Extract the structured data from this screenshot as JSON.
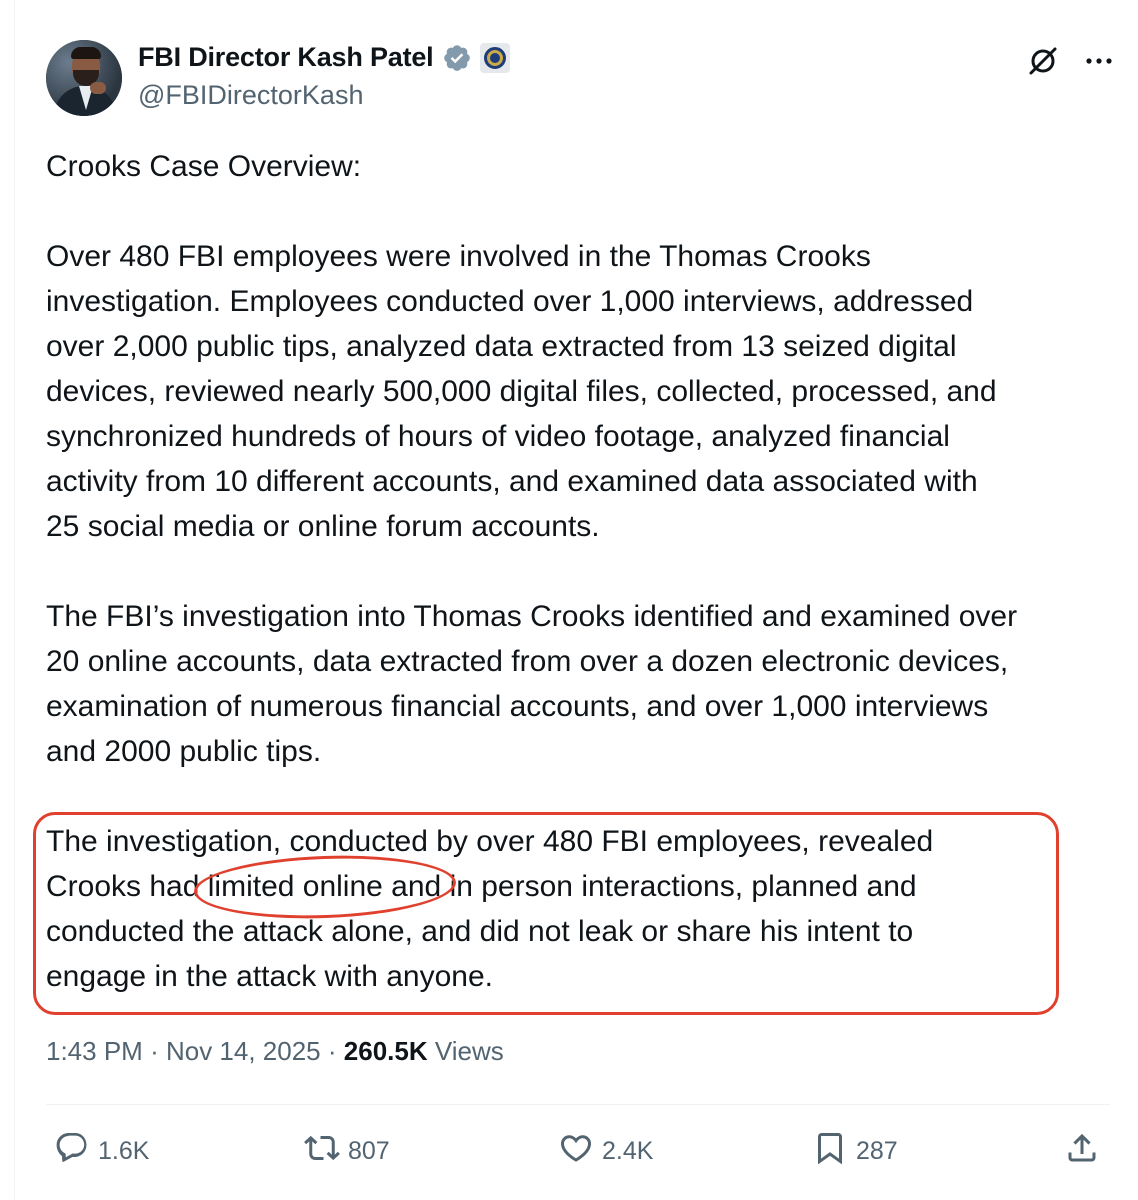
{
  "author": {
    "display_name": "FBI Director Kash Patel",
    "handle": "@FBIDirectorKash"
  },
  "icons": {
    "verified": "verified-badge-icon",
    "affiliation": "fbi-seal-icon",
    "grok": "grok-icon",
    "more": "more-icon"
  },
  "post": {
    "title_line": "Crooks Case Overview:",
    "paragraph_1": "Over 480 FBI employees were involved in the Thomas Crooks\ninvestigation. Employees conducted over 1,000 interviews, addressed\nover 2,000 public tips, analyzed data extracted from 13 seized digital\ndevices, reviewed nearly 500,000 digital files, collected, processed, and\nsynchronized hundreds of hours of video footage, analyzed financial\nactivity from 10 different accounts, and examined data associated with\n25 social media or online forum accounts.",
    "paragraph_2": "The FBI’s investigation into Thomas Crooks identified and examined over\n20 online accounts, data extracted from over a dozen electronic devices,\nexamination of numerous financial accounts, and over 1,000 interviews\nand 2000 public tips.",
    "paragraph_3": "The investigation, conducted by over 480 FBI employees, revealed\nCrooks had limited online and in person interactions, planned and\nconducted the attack alone, and did not leak or share his intent to\nengage in the attack with anyone."
  },
  "annotation": {
    "color": "#e0412f"
  },
  "meta": {
    "time": "1:43 PM",
    "separator": "·",
    "date": "Nov 14, 2025",
    "views_count": "260.5K",
    "views_label": "Views"
  },
  "actions": {
    "replies": "1.6K",
    "reposts": "807",
    "likes": "2.4K",
    "bookmarks": "287"
  },
  "colors": {
    "text": "#0f1419",
    "secondary": "#536471",
    "verified_blue": "#829aab"
  }
}
